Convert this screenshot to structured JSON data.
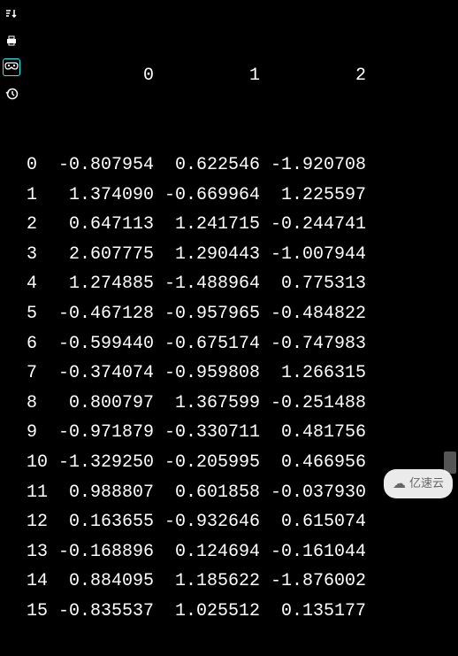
{
  "toolbar": {
    "items": [
      {
        "name": "sort-icon"
      },
      {
        "name": "print-icon"
      },
      {
        "name": "mask-icon",
        "active": true
      },
      {
        "name": "history-icon"
      }
    ]
  },
  "table": {
    "columns": [
      "0",
      "1",
      "2"
    ],
    "rows": [
      {
        "idx": "0",
        "c0": "-0.807954",
        "c1": "0.622546",
        "c2": "-1.920708"
      },
      {
        "idx": "1",
        "c0": "1.374090",
        "c1": "-0.669964",
        "c2": "1.225597"
      },
      {
        "idx": "2",
        "c0": "0.647113",
        "c1": "1.241715",
        "c2": "-0.244741"
      },
      {
        "idx": "3",
        "c0": "2.607775",
        "c1": "1.290443",
        "c2": "-1.007944"
      },
      {
        "idx": "4",
        "c0": "1.274885",
        "c1": "-1.488964",
        "c2": "0.775313"
      },
      {
        "idx": "5",
        "c0": "-0.467128",
        "c1": "-0.957965",
        "c2": "-0.484822"
      },
      {
        "idx": "6",
        "c0": "-0.599440",
        "c1": "-0.675174",
        "c2": "-0.747983"
      },
      {
        "idx": "7",
        "c0": "-0.374074",
        "c1": "-0.959808",
        "c2": "1.266315"
      },
      {
        "idx": "8",
        "c0": "0.800797",
        "c1": "1.367599",
        "c2": "-0.251488"
      },
      {
        "idx": "9",
        "c0": "-0.971879",
        "c1": "-0.330711",
        "c2": "0.481756"
      },
      {
        "idx": "10",
        "c0": "-1.329250",
        "c1": "-0.205995",
        "c2": "0.466956"
      },
      {
        "idx": "11",
        "c0": "0.988807",
        "c1": "0.601858",
        "c2": "-0.037930"
      },
      {
        "idx": "12",
        "c0": "0.163655",
        "c1": "-0.932646",
        "c2": "0.615074"
      },
      {
        "idx": "13",
        "c0": "-0.168896",
        "c1": "0.124694",
        "c2": "-0.161044"
      },
      {
        "idx": "14",
        "c0": "0.884095",
        "c1": "1.185622",
        "c2": "-1.876002"
      },
      {
        "idx": "15",
        "c0": "-0.835537",
        "c1": "1.025512",
        "c2": "0.135177"
      }
    ]
  },
  "watermark": {
    "text": "亿速云"
  }
}
